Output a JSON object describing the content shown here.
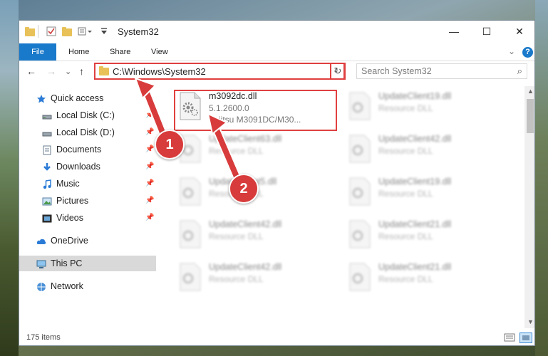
{
  "window": {
    "title": "System32",
    "controls": {
      "minimize": "—",
      "maximize": "☐",
      "close": "✕"
    }
  },
  "ribbon": {
    "tabs": [
      "File",
      "Home",
      "Share",
      "View"
    ],
    "collapse": "⌄",
    "help": "?"
  },
  "navbar": {
    "back": "←",
    "forward": "→",
    "recent": "⌄",
    "up": "↑",
    "address": "C:\\Windows\\System32",
    "address_dropdown": "⌄",
    "refresh": "↻",
    "search_placeholder": "Search System32",
    "search_icon": "⌕"
  },
  "sidebar": {
    "items": [
      {
        "label": "Quick access",
        "icon": "star-icon",
        "pinned": false
      },
      {
        "label": "Local Disk (C:)",
        "icon": "drive-icon",
        "pinned": true
      },
      {
        "label": "Local Disk (D:)",
        "icon": "drive-icon",
        "pinned": true
      },
      {
        "label": "Documents",
        "icon": "document-icon",
        "pinned": true
      },
      {
        "label": "Downloads",
        "icon": "download-icon",
        "pinned": true
      },
      {
        "label": "Music",
        "icon": "music-icon",
        "pinned": true
      },
      {
        "label": "Pictures",
        "icon": "pictures-icon",
        "pinned": true
      },
      {
        "label": "Videos",
        "icon": "video-icon",
        "pinned": true
      },
      {
        "label": "OneDrive",
        "icon": "cloud-icon",
        "pinned": false
      },
      {
        "label": "This PC",
        "icon": "computer-icon",
        "pinned": false,
        "selected": true
      },
      {
        "label": "Network",
        "icon": "network-icon",
        "pinned": false
      }
    ],
    "pin_glyph": "📌"
  },
  "files": {
    "highlighted": {
      "name": "m3092dc.dll",
      "version": "5.1.2600.0",
      "company": "Fujitsu M3091DC/M30..."
    },
    "left_column": [
      {
        "name": "UpdateClient63.dll",
        "type": "Resource DLL"
      },
      {
        "name": "UpdateClient5.dll",
        "type": "Resource DLL"
      },
      {
        "name": "UpdateClient42.dll",
        "type": "Resource DLL"
      },
      {
        "name": "UpdateClient42.dll",
        "type": "Resource DLL"
      }
    ],
    "right_column": [
      {
        "name": "UpdateClient19.dll",
        "type": "Resource DLL"
      },
      {
        "name": "UpdateClient42.dll",
        "type": "Resource DLL"
      },
      {
        "name": "UpdateClient19.dll",
        "type": "Resource DLL"
      },
      {
        "name": "UpdateClient21.dll",
        "type": "Resource DLL"
      },
      {
        "name": "UpdateClient21.dll",
        "type": "Resource DLL"
      }
    ]
  },
  "status": {
    "count": "175 items"
  },
  "annotations": {
    "badge1": "1",
    "badge2": "2"
  },
  "colors": {
    "accent": "#1979ca",
    "highlight": "#e04040",
    "badge": "#d83b3b"
  }
}
